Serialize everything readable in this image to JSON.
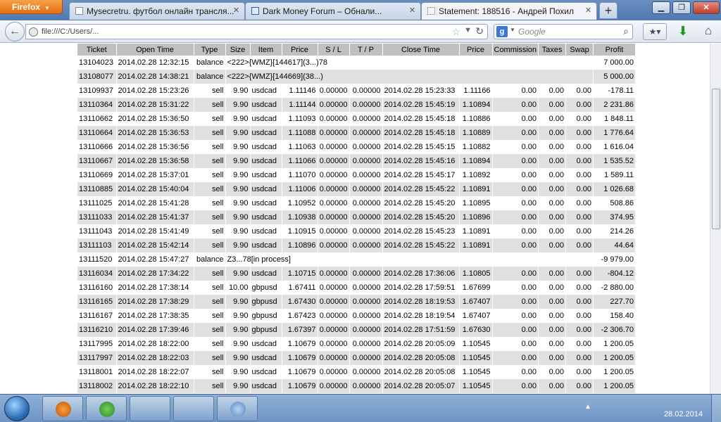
{
  "browser": {
    "app_button": "Firefox",
    "tabs": [
      {
        "title": "Mysecretru. футбол онлайн трансля...",
        "active": false
      },
      {
        "title": "Dark Money Forum – Обнали...",
        "active": false
      },
      {
        "title": "Statement: 188516 - Андрей Похил",
        "active": true
      }
    ],
    "url": "file:///C:/Users/...",
    "search_placeholder": "Google",
    "search_engine_letter": "g"
  },
  "table": {
    "headers": [
      "Ticket",
      "Open Time",
      "Type",
      "Size",
      "Item",
      "Price",
      "S / L",
      "T / P",
      "Close Time",
      "Price",
      "Commission",
      "Taxes",
      "Swap",
      "Profit"
    ],
    "rows": [
      {
        "kind": "balance",
        "ticket": "13104023",
        "open_time": "2014.02.28 12:32:15",
        "type": "balance",
        "comment": "<222>{WMZ}[144617](3...)78",
        "profit": "7 000.00"
      },
      {
        "kind": "balance",
        "ticket": "13108077",
        "open_time": "2014.02.28 14:38:21",
        "type": "balance",
        "comment": "<222>{WMZ}[144669](38...)",
        "profit": "5 000.00"
      },
      {
        "kind": "trade",
        "ticket": "13109937",
        "open_time": "2014.02.28 15:23:26",
        "type": "sell",
        "size": "9.90",
        "item": "usdcad",
        "price": "1.11146",
        "sl": "0.00000",
        "tp": "0.00000",
        "close_time": "2014.02.28 15:23:33",
        "close_price": "1.11166",
        "commission": "0.00",
        "taxes": "0.00",
        "swap": "0.00",
        "profit": "-178.11"
      },
      {
        "kind": "trade",
        "ticket": "13110364",
        "open_time": "2014.02.28 15:31:22",
        "type": "sell",
        "size": "9.90",
        "item": "usdcad",
        "price": "1.11144",
        "sl": "0.00000",
        "tp": "0.00000",
        "close_time": "2014.02.28 15:45:19",
        "close_price": "1.10894",
        "commission": "0.00",
        "taxes": "0.00",
        "swap": "0.00",
        "profit": "2 231.86"
      },
      {
        "kind": "trade",
        "ticket": "13110662",
        "open_time": "2014.02.28 15:36:50",
        "type": "sell",
        "size": "9.90",
        "item": "usdcad",
        "price": "1.11093",
        "sl": "0.00000",
        "tp": "0.00000",
        "close_time": "2014.02.28 15:45:18",
        "close_price": "1.10886",
        "commission": "0.00",
        "taxes": "0.00",
        "swap": "0.00",
        "profit": "1 848.11"
      },
      {
        "kind": "trade",
        "ticket": "13110664",
        "open_time": "2014.02.28 15:36:53",
        "type": "sell",
        "size": "9.90",
        "item": "usdcad",
        "price": "1.11088",
        "sl": "0.00000",
        "tp": "0.00000",
        "close_time": "2014.02.28 15:45:18",
        "close_price": "1.10889",
        "commission": "0.00",
        "taxes": "0.00",
        "swap": "0.00",
        "profit": "1 776.64"
      },
      {
        "kind": "trade",
        "ticket": "13110666",
        "open_time": "2014.02.28 15:36:56",
        "type": "sell",
        "size": "9.90",
        "item": "usdcad",
        "price": "1.11063",
        "sl": "0.00000",
        "tp": "0.00000",
        "close_time": "2014.02.28 15:45:15",
        "close_price": "1.10882",
        "commission": "0.00",
        "taxes": "0.00",
        "swap": "0.00",
        "profit": "1 616.04"
      },
      {
        "kind": "trade",
        "ticket": "13110667",
        "open_time": "2014.02.28 15:36:58",
        "type": "sell",
        "size": "9.90",
        "item": "usdcad",
        "price": "1.11066",
        "sl": "0.00000",
        "tp": "0.00000",
        "close_time": "2014.02.28 15:45:16",
        "close_price": "1.10894",
        "commission": "0.00",
        "taxes": "0.00",
        "swap": "0.00",
        "profit": "1 535.52"
      },
      {
        "kind": "trade",
        "ticket": "13110669",
        "open_time": "2014.02.28 15:37:01",
        "type": "sell",
        "size": "9.90",
        "item": "usdcad",
        "price": "1.11070",
        "sl": "0.00000",
        "tp": "0.00000",
        "close_time": "2014.02.28 15:45:17",
        "close_price": "1.10892",
        "commission": "0.00",
        "taxes": "0.00",
        "swap": "0.00",
        "profit": "1 589.11"
      },
      {
        "kind": "trade",
        "ticket": "13110885",
        "open_time": "2014.02.28 15:40:04",
        "type": "sell",
        "size": "9.90",
        "item": "usdcad",
        "price": "1.11006",
        "sl": "0.00000",
        "tp": "0.00000",
        "close_time": "2014.02.28 15:45:22",
        "close_price": "1.10891",
        "commission": "0.00",
        "taxes": "0.00",
        "swap": "0.00",
        "profit": "1 026.68"
      },
      {
        "kind": "trade",
        "ticket": "13111025",
        "open_time": "2014.02.28 15:41:28",
        "type": "sell",
        "size": "9.90",
        "item": "usdcad",
        "price": "1.10952",
        "sl": "0.00000",
        "tp": "0.00000",
        "close_time": "2014.02.28 15:45:20",
        "close_price": "1.10895",
        "commission": "0.00",
        "taxes": "0.00",
        "swap": "0.00",
        "profit": "508.86"
      },
      {
        "kind": "trade",
        "ticket": "13111033",
        "open_time": "2014.02.28 15:41:37",
        "type": "sell",
        "size": "9.90",
        "item": "usdcad",
        "price": "1.10938",
        "sl": "0.00000",
        "tp": "0.00000",
        "close_time": "2014.02.28 15:45:20",
        "close_price": "1.10896",
        "commission": "0.00",
        "taxes": "0.00",
        "swap": "0.00",
        "profit": "374.95"
      },
      {
        "kind": "trade",
        "ticket": "13111043",
        "open_time": "2014.02.28 15:41:49",
        "type": "sell",
        "size": "9.90",
        "item": "usdcad",
        "price": "1.10915",
        "sl": "0.00000",
        "tp": "0.00000",
        "close_time": "2014.02.28 15:45:23",
        "close_price": "1.10891",
        "commission": "0.00",
        "taxes": "0.00",
        "swap": "0.00",
        "profit": "214.26"
      },
      {
        "kind": "trade",
        "ticket": "13111103",
        "open_time": "2014.02.28 15:42:14",
        "type": "sell",
        "size": "9.90",
        "item": "usdcad",
        "price": "1.10896",
        "sl": "0.00000",
        "tp": "0.00000",
        "close_time": "2014.02.28 15:45:22",
        "close_price": "1.10891",
        "commission": "0.00",
        "taxes": "0.00",
        "swap": "0.00",
        "profit": "44.64"
      },
      {
        "kind": "balance",
        "ticket": "13111520",
        "open_time": "2014.02.28 15:47:27",
        "type": "balance",
        "comment": "Z3...78[in process]",
        "profit": "-9 979.00"
      },
      {
        "kind": "trade",
        "ticket": "13116034",
        "open_time": "2014.02.28 17:34:22",
        "type": "sell",
        "size": "9.90",
        "item": "usdcad",
        "price": "1.10715",
        "sl": "0.00000",
        "tp": "0.00000",
        "close_time": "2014.02.28 17:36:06",
        "close_price": "1.10805",
        "commission": "0.00",
        "taxes": "0.00",
        "swap": "0.00",
        "profit": "-804.12"
      },
      {
        "kind": "trade",
        "ticket": "13116160",
        "open_time": "2014.02.28 17:38:14",
        "type": "sell",
        "size": "10.00",
        "item": "gbpusd",
        "price": "1.67411",
        "sl": "0.00000",
        "tp": "0.00000",
        "close_time": "2014.02.28 17:59:51",
        "close_price": "1.67699",
        "commission": "0.00",
        "taxes": "0.00",
        "swap": "0.00",
        "profit": "-2 880.00"
      },
      {
        "kind": "trade",
        "ticket": "13116165",
        "open_time": "2014.02.28 17:38:29",
        "type": "sell",
        "size": "9.90",
        "item": "gbpusd",
        "price": "1.67430",
        "sl": "0.00000",
        "tp": "0.00000",
        "close_time": "2014.02.28 18:19:53",
        "close_price": "1.67407",
        "commission": "0.00",
        "taxes": "0.00",
        "swap": "0.00",
        "profit": "227.70"
      },
      {
        "kind": "trade",
        "ticket": "13116167",
        "open_time": "2014.02.28 17:38:35",
        "type": "sell",
        "size": "9.90",
        "item": "gbpusd",
        "price": "1.67423",
        "sl": "0.00000",
        "tp": "0.00000",
        "close_time": "2014.02.28 18:19:54",
        "close_price": "1.67407",
        "commission": "0.00",
        "taxes": "0.00",
        "swap": "0.00",
        "profit": "158.40"
      },
      {
        "kind": "trade",
        "ticket": "13116210",
        "open_time": "2014.02.28 17:39:46",
        "type": "sell",
        "size": "9.90",
        "item": "gbpusd",
        "price": "1.67397",
        "sl": "0.00000",
        "tp": "0.00000",
        "close_time": "2014.02.28 17:51:59",
        "close_price": "1.67630",
        "commission": "0.00",
        "taxes": "0.00",
        "swap": "0.00",
        "profit": "-2 306.70"
      },
      {
        "kind": "trade",
        "ticket": "13117995",
        "open_time": "2014.02.28 18:22:00",
        "type": "sell",
        "size": "9.90",
        "item": "usdcad",
        "price": "1.10679",
        "sl": "0.00000",
        "tp": "0.00000",
        "close_time": "2014.02.28 20:05:09",
        "close_price": "1.10545",
        "commission": "0.00",
        "taxes": "0.00",
        "swap": "0.00",
        "profit": "1 200.05"
      },
      {
        "kind": "trade",
        "ticket": "13117997",
        "open_time": "2014.02.28 18:22:03",
        "type": "sell",
        "size": "9.90",
        "item": "usdcad",
        "price": "1.10679",
        "sl": "0.00000",
        "tp": "0.00000",
        "close_time": "2014.02.28 20:05:08",
        "close_price": "1.10545",
        "commission": "0.00",
        "taxes": "0.00",
        "swap": "0.00",
        "profit": "1 200.05"
      },
      {
        "kind": "trade",
        "ticket": "13118001",
        "open_time": "2014.02.28 18:22:07",
        "type": "sell",
        "size": "9.90",
        "item": "usdcad",
        "price": "1.10679",
        "sl": "0.00000",
        "tp": "0.00000",
        "close_time": "2014.02.28 20:05:08",
        "close_price": "1.10545",
        "commission": "0.00",
        "taxes": "0.00",
        "swap": "0.00",
        "profit": "1 200.05"
      },
      {
        "kind": "trade",
        "ticket": "13118002",
        "open_time": "2014.02.28 18:22:10",
        "type": "sell",
        "size": "9.90",
        "item": "usdcad",
        "price": "1.10679",
        "sl": "0.00000",
        "tp": "0.00000",
        "close_time": "2014.02.28 20:05:07",
        "close_price": "1.10545",
        "commission": "0.00",
        "taxes": "0.00",
        "swap": "0.00",
        "profit": "1 200.05"
      }
    ]
  },
  "taskbar": {
    "date": "28.02.2014"
  },
  "colors": {
    "header_bg": "#c0c0c0",
    "alt_row_bg": "#e0e0e0",
    "firefox_orange": "#e56f12",
    "taskbar_blue": "#7ba0cc"
  }
}
